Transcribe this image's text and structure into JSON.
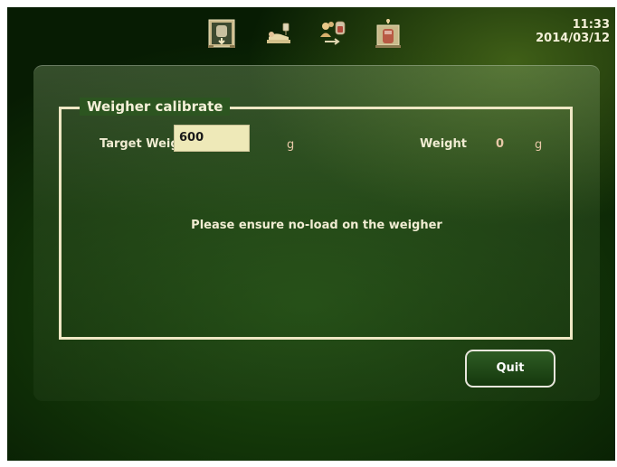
{
  "header": {
    "time": "11:33",
    "date": "2014/03/12",
    "mode_icons": [
      "weigher-bag-icon",
      "patient-bed-icon",
      "donor-transfer-icon",
      "bag-hanger-icon"
    ]
  },
  "calibration": {
    "title": "Weigher calibrate",
    "target_weight_label": "Target Weight",
    "target_weight_value": "600",
    "target_unit": "g",
    "weight_label": "Weight",
    "weight_value": "0",
    "weight_unit": "g",
    "message": "Please ensure no-load on the weigher"
  },
  "actions": {
    "quit_label": "Quit"
  },
  "colors": {
    "accent_frame": "#eee7c4",
    "input_background": "#eee9b8",
    "unit_text": "#e8c8a8"
  }
}
